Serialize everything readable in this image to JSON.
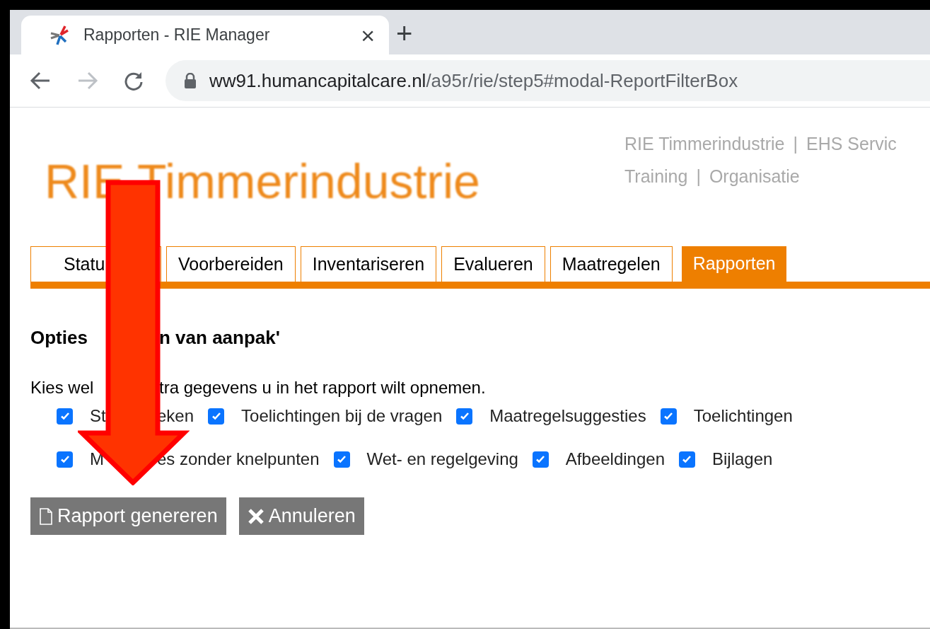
{
  "browser": {
    "tab": {
      "title": "Rapporten - RIE Manager",
      "close": "×"
    },
    "new_tab": "+",
    "url": {
      "host": "ww91.humancapitalcare.nl",
      "path": "/a95r/rie/step5#modal-ReportFilterBox"
    }
  },
  "header": {
    "title": "RIE Timmerindustrie",
    "links": [
      [
        "RIE Timmerindustrie",
        "EHS Servic"
      ],
      [
        "Training",
        "Organisatie"
      ]
    ],
    "separator": "|"
  },
  "nav_tabs": [
    {
      "label": "Statu",
      "selected": false
    },
    {
      "label": "Voorbereiden",
      "selected": false
    },
    {
      "label": "Inventariseren",
      "selected": false
    },
    {
      "label": "Evalueren",
      "selected": false
    },
    {
      "label": "Maatregelen",
      "selected": false
    },
    {
      "label": "Rapporten",
      "selected": true
    }
  ],
  "heading_parts": [
    "Opties",
    "n van aanpak'"
  ],
  "intro_parts": [
    "Kies wel",
    "tra gegevens u in het rapport wilt opnemen."
  ],
  "options": [
    [
      {
        "label_parts": [
          "St",
          "eken"
        ],
        "checked": true
      },
      {
        "label_parts": [
          "Toelichtingen bij de vragen"
        ],
        "checked": true
      },
      {
        "label_parts": [
          "Maatregelsuggesties"
        ],
        "checked": true
      },
      {
        "label_parts": [
          "Toelichtingen"
        ],
        "checked": true
      }
    ],
    [
      {
        "label_parts": [
          "M",
          "es zonder knelpunten"
        ],
        "checked": true
      },
      {
        "label_parts": [
          "Wet- en regelgeving"
        ],
        "checked": true
      },
      {
        "label_parts": [
          "Afbeeldingen"
        ],
        "checked": true
      },
      {
        "label_parts": [
          "Bijlagen"
        ],
        "checked": true
      }
    ]
  ],
  "buttons": [
    {
      "kind": "generate",
      "label": "Rapport genereren"
    },
    {
      "kind": "cancel",
      "label": "Annuleren"
    }
  ]
}
